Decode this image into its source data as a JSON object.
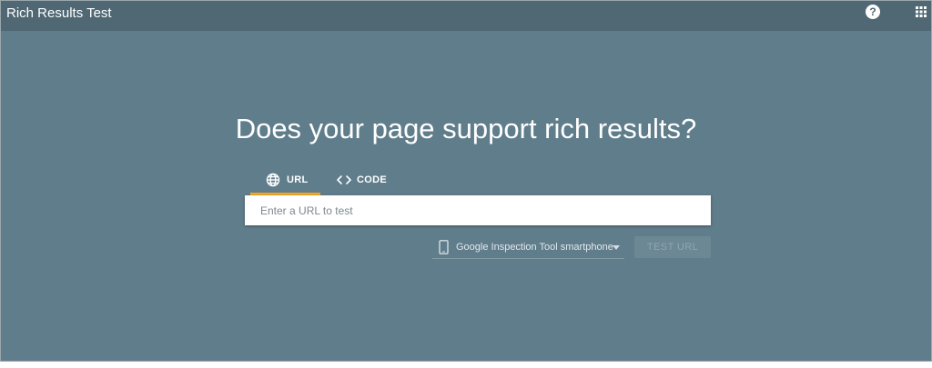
{
  "header": {
    "title": "Rich Results Test",
    "help_icon": "?",
    "apps_icon": "apps-grid-icon"
  },
  "main": {
    "headline": "Does your page support rich results?",
    "tabs": [
      {
        "label": "URL",
        "icon": "globe-icon",
        "selected": true
      },
      {
        "label": "CODE",
        "icon": "code-brackets-icon",
        "selected": false
      }
    ],
    "url_input": {
      "value": "",
      "placeholder": "Enter a URL to test"
    },
    "device_select": {
      "selected": "Google Inspection Tool smartphone",
      "icon": "smartphone-icon"
    },
    "test_button": {
      "label": "TEST URL",
      "enabled": false
    }
  },
  "colors": {
    "header_bg": "#4f6873",
    "page_bg": "#607d8b",
    "tab_indicator": "#f5a623",
    "disabled_button_bg": "#6c8894"
  }
}
